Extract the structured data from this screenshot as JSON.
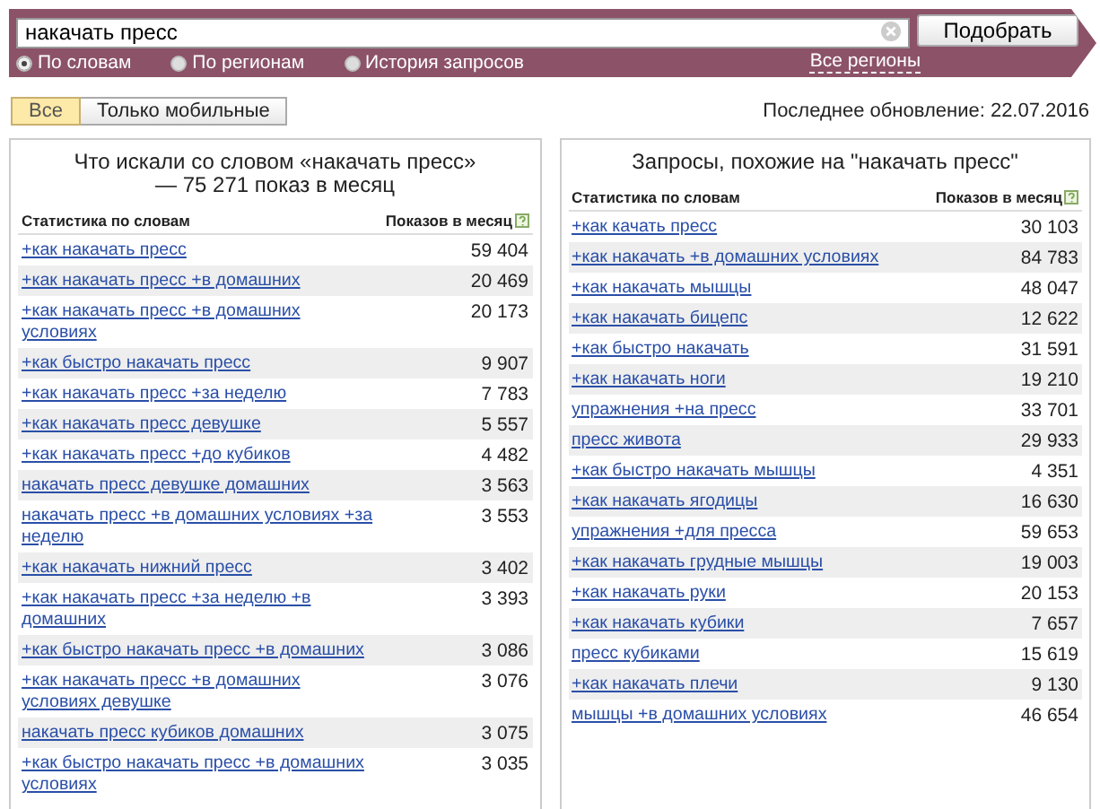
{
  "search": {
    "value": "накачать пресс",
    "button": "Подобрать"
  },
  "modes": [
    {
      "label": "По словам",
      "selected": true
    },
    {
      "label": "По регионам",
      "selected": false
    },
    {
      "label": "История запросов",
      "selected": false
    }
  ],
  "region_link": "Все регионы",
  "filters": [
    {
      "label": "Все",
      "selected": true
    },
    {
      "label": "Только мобильные",
      "selected": false
    }
  ],
  "last_update": "Последнее обновление: 22.07.2016",
  "panels": [
    {
      "title": "Что искали со словом «накачать пресс» — 75 271 показ в месяц",
      "columns": [
        "Статистика по словам",
        "Показов в месяц"
      ],
      "rows": [
        {
          "phrase": "+как накачать пресс",
          "count": "59 404"
        },
        {
          "phrase": "+как накачать пресс +в домашних",
          "count": "20 469"
        },
        {
          "phrase": "+как накачать пресс +в домашних условиях",
          "count": "20 173"
        },
        {
          "phrase": "+как быстро накачать пресс",
          "count": "9 907"
        },
        {
          "phrase": "+как накачать пресс +за неделю",
          "count": "7 783"
        },
        {
          "phrase": "+как накачать пресс девушке",
          "count": "5 557"
        },
        {
          "phrase": "+как накачать пресс +до кубиков",
          "count": "4 482"
        },
        {
          "phrase": "накачать пресс девушке домашних",
          "count": "3 563"
        },
        {
          "phrase": "накачать пресс +в домашних условиях +за неделю",
          "count": "3 553"
        },
        {
          "phrase": "+как накачать нижний пресс",
          "count": "3 402"
        },
        {
          "phrase": "+как накачать пресс +за неделю +в домашних",
          "count": "3 393"
        },
        {
          "phrase": "+как быстро накачать пресс +в домашних",
          "count": "3 086"
        },
        {
          "phrase": "+как накачать пресс +в домашних условиях девушке",
          "count": "3 076"
        },
        {
          "phrase": "накачать пресс кубиков домашних",
          "count": "3 075"
        },
        {
          "phrase": "+как быстро накачать пресс +в домашних условиях",
          "count": "3 035"
        }
      ]
    },
    {
      "title": "Запросы, похожие на \"накачать пресс\"",
      "columns": [
        "Статистика по словам",
        "Показов в месяц"
      ],
      "rows": [
        {
          "phrase": "+как качать пресс",
          "count": "30 103"
        },
        {
          "phrase": "+как накачать +в домашних условиях",
          "count": "84 783"
        },
        {
          "phrase": "+как накачать мышцы",
          "count": "48 047"
        },
        {
          "phrase": "+как накачать бицепс",
          "count": "12 622"
        },
        {
          "phrase": "+как быстро накачать",
          "count": "31 591"
        },
        {
          "phrase": "+как накачать ноги",
          "count": "19 210"
        },
        {
          "phrase": "упражнения +на пресс",
          "count": "33 701"
        },
        {
          "phrase": "пресс живота",
          "count": "29 933"
        },
        {
          "phrase": "+как быстро накачать мышцы",
          "count": "4 351"
        },
        {
          "phrase": "+как накачать ягодицы",
          "count": "16 630"
        },
        {
          "phrase": "упражнения +для пресса",
          "count": "59 653"
        },
        {
          "phrase": "+как накачать грудные мышцы",
          "count": "19 003"
        },
        {
          "phrase": "+как накачать руки",
          "count": "20 153"
        },
        {
          "phrase": "+как накачать кубики",
          "count": "7 657"
        },
        {
          "phrase": "пресс кубиками",
          "count": "15 619"
        },
        {
          "phrase": "+как накачать плечи",
          "count": "9 130"
        },
        {
          "phrase": "мышцы +в домашних условиях",
          "count": "46 654"
        }
      ]
    }
  ]
}
